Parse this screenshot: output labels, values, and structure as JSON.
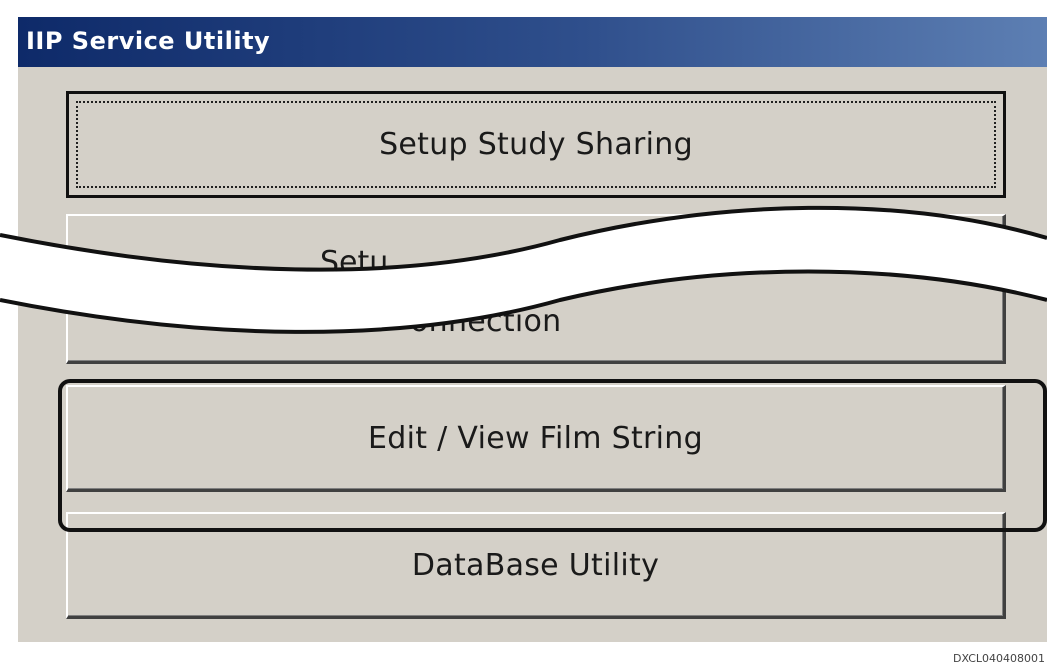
{
  "window": {
    "title": "IIP Service Utility"
  },
  "buttons": {
    "setup_study_sharing": "Setup Study Sharing",
    "setup_connection_top": "Setu",
    "setup_connection_bottom": "onnection",
    "edit_view_film_string": "Edit / View Film String",
    "database_utility": "DataBase Utility"
  },
  "figure_code": "DXCL040408001"
}
